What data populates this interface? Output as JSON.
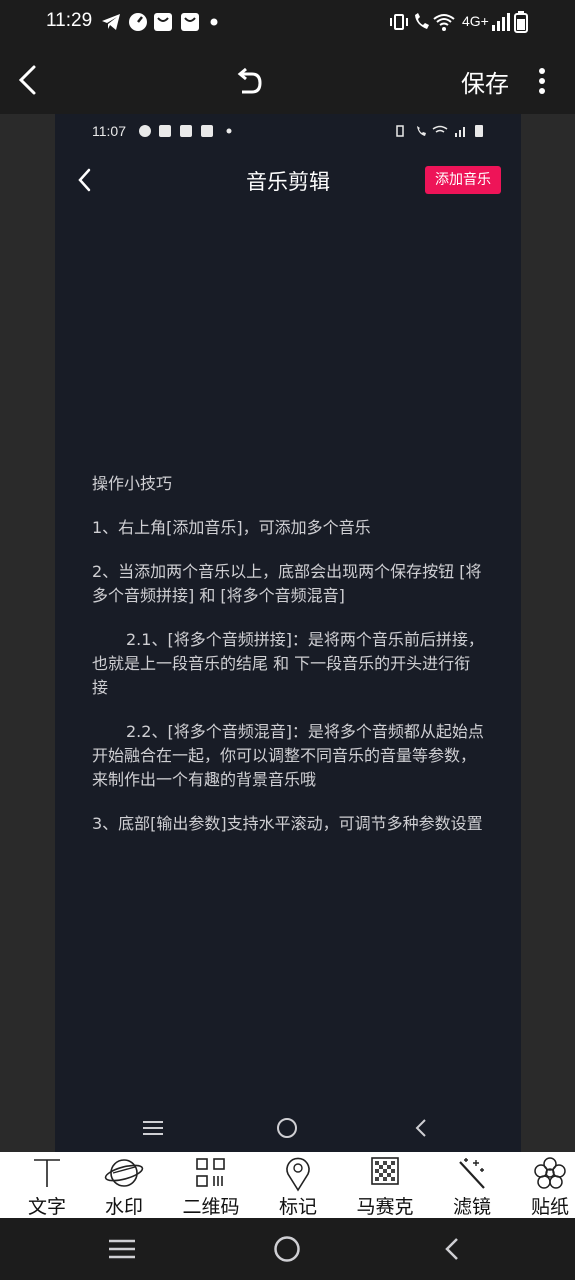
{
  "status_bar": {
    "time": "11:29",
    "network": "4G+"
  },
  "top_bar": {
    "save_label": "保存"
  },
  "preview": {
    "status_time": "11:07",
    "title": "音乐剪辑",
    "add_button": "添加音乐",
    "tips": [
      "操作小技巧",
      "1、右上角[添加音乐]，可添加多个音乐",
      "2、当添加两个音乐以上，底部会出现两个保存按钮 [将多个音频拼接] 和 [将多个音频混音]",
      "2.1、[将多个音频拼接]：是将两个音乐前后拼接，也就是上一段音乐的结尾 和 下一段音乐的开头进行衔接",
      "2.2、[将多个音频混音]：是将多个音频都从起始点开始融合在一起，你可以调整不同音乐的音量等参数，来制作出一个有趣的背景音乐哦",
      "3、底部[输出参数]支持水平滚动，可调节多种参数设置"
    ]
  },
  "tools": [
    {
      "label": "文字",
      "icon": "text-icon"
    },
    {
      "label": "水印",
      "icon": "watermark-icon"
    },
    {
      "label": "二维码",
      "icon": "qrcode-icon"
    },
    {
      "label": "标记",
      "icon": "marker-icon"
    },
    {
      "label": "马赛克",
      "icon": "mosaic-icon"
    },
    {
      "label": "滤镜",
      "icon": "filter-wand-icon"
    },
    {
      "label": "贴纸",
      "icon": "sticker-icon"
    }
  ]
}
